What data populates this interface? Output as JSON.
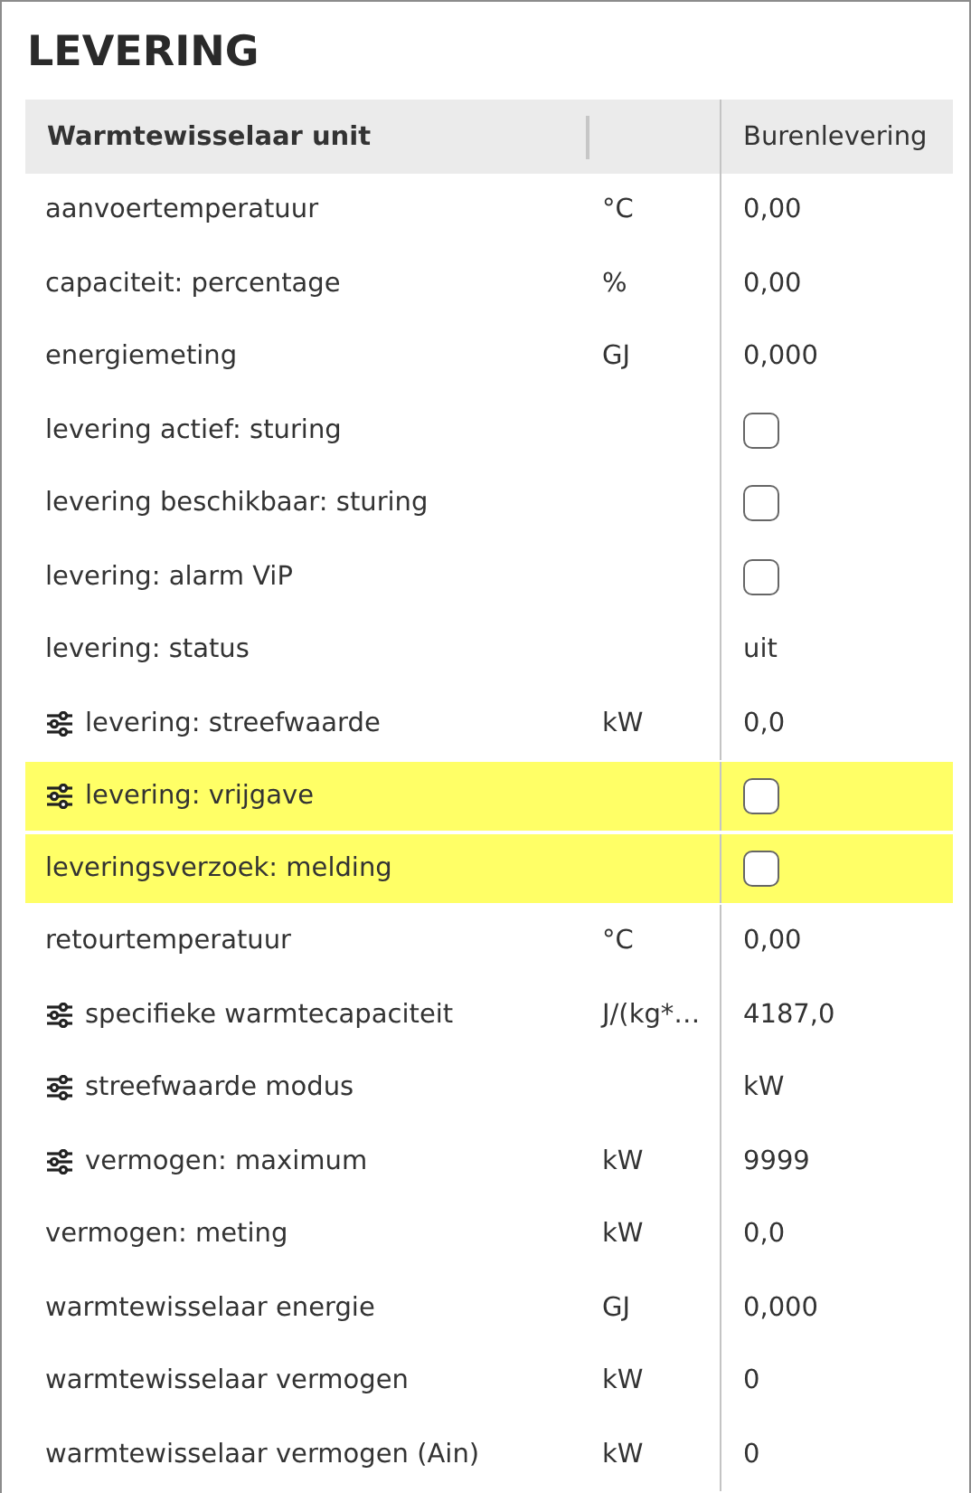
{
  "title": "LEVERING",
  "columns": [
    "Warmtewisselaar unit",
    "Burenlevering"
  ],
  "rows": [
    {
      "name": "aanvoertemperatuur",
      "unit": "°C",
      "kind": "text",
      "value": "0,00",
      "adjustable": false,
      "highlighted": false
    },
    {
      "name": "capaciteit: percentage",
      "unit": "%",
      "kind": "text",
      "value": "0,00",
      "adjustable": false,
      "highlighted": false
    },
    {
      "name": "energiemeting",
      "unit": "GJ",
      "kind": "text",
      "value": "0,000",
      "adjustable": false,
      "highlighted": false
    },
    {
      "name": "levering actief: sturing",
      "kind": "checkbox",
      "checked": false,
      "adjustable": false,
      "highlighted": false
    },
    {
      "name": "levering beschikbaar: sturing",
      "kind": "checkbox",
      "checked": false,
      "adjustable": false,
      "highlighted": false
    },
    {
      "name": "levering: alarm ViP",
      "kind": "checkbox",
      "checked": false,
      "adjustable": false,
      "highlighted": false
    },
    {
      "name": "levering: status",
      "kind": "text",
      "value": "uit",
      "adjustable": false,
      "highlighted": false
    },
    {
      "name": "levering: streefwaarde",
      "unit": "kW",
      "kind": "text",
      "value": "0,0",
      "adjustable": true,
      "highlighted": false
    },
    {
      "name": "levering: vrijgave",
      "kind": "checkbox",
      "checked": false,
      "adjustable": true,
      "highlighted": true
    },
    {
      "name": "leveringsverzoek: melding",
      "kind": "checkbox",
      "checked": false,
      "adjustable": false,
      "highlighted": true
    },
    {
      "name": "retourtemperatuur",
      "unit": "°C",
      "kind": "text",
      "value": "0,00",
      "adjustable": false,
      "highlighted": false
    },
    {
      "name": "specifieke warmtecapaciteit",
      "unit": "J/(kg*…",
      "kind": "text",
      "value": "4187,0",
      "adjustable": true,
      "highlighted": false
    },
    {
      "name": "streefwaarde modus",
      "kind": "text",
      "value": "kW",
      "adjustable": true,
      "highlighted": false
    },
    {
      "name": "vermogen: maximum",
      "unit": "kW",
      "kind": "text",
      "value": "9999",
      "adjustable": true,
      "highlighted": false
    },
    {
      "name": "vermogen: meting",
      "unit": "kW",
      "kind": "text",
      "value": "0,0",
      "adjustable": false,
      "highlighted": false
    },
    {
      "name": "warmtewisselaar energie",
      "unit": "GJ",
      "kind": "text",
      "value": "0,000",
      "adjustable": false,
      "highlighted": false
    },
    {
      "name": "warmtewisselaar vermogen",
      "unit": "kW",
      "kind": "text",
      "value": "0",
      "adjustable": false,
      "highlighted": false
    },
    {
      "name": "warmtewisselaar vermogen (Ain)",
      "unit": "kW",
      "kind": "text",
      "value": "0",
      "adjustable": false,
      "highlighted": false
    }
  ]
}
